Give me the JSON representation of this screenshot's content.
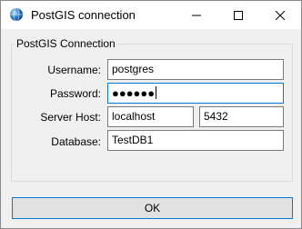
{
  "window": {
    "title": "PostGIS connection",
    "icon": "globe-icon"
  },
  "group": {
    "title": "PostGIS Connection"
  },
  "form": {
    "username_label": "Username:",
    "username_value": "postgres",
    "password_label": "Password:",
    "password_value": "●●●●●●",
    "server_label": "Server Host:",
    "host_value": "localhost",
    "port_value": "5432",
    "database_label": "Database:",
    "database_value": "TestDB1"
  },
  "buttons": {
    "ok_label": "OK"
  },
  "colors": {
    "accent": "#0078d7",
    "window_bg": "#f0f0f0"
  }
}
